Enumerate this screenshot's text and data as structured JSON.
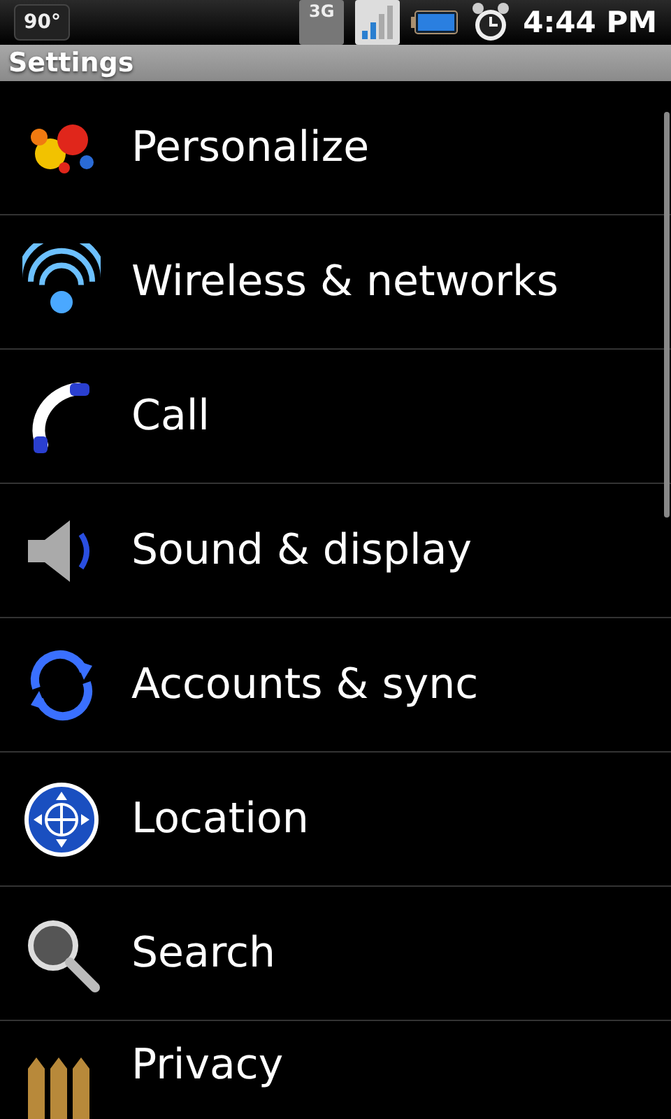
{
  "status_bar": {
    "orientation_badge": "90°",
    "network": "3G",
    "time": "4:44 PM"
  },
  "title_bar": {
    "title": "Settings"
  },
  "items": [
    {
      "label": "Personalize",
      "kind": "paint"
    },
    {
      "label": "Wireless & networks",
      "kind": "wifi"
    },
    {
      "label": "Call",
      "kind": "phone"
    },
    {
      "label": "Sound & display",
      "kind": "speaker"
    },
    {
      "label": "Accounts & sync",
      "kind": "sync"
    },
    {
      "label": "Location",
      "kind": "globe"
    },
    {
      "label": "Search",
      "kind": "search"
    },
    {
      "label": "Privacy",
      "kind": "fence"
    }
  ]
}
